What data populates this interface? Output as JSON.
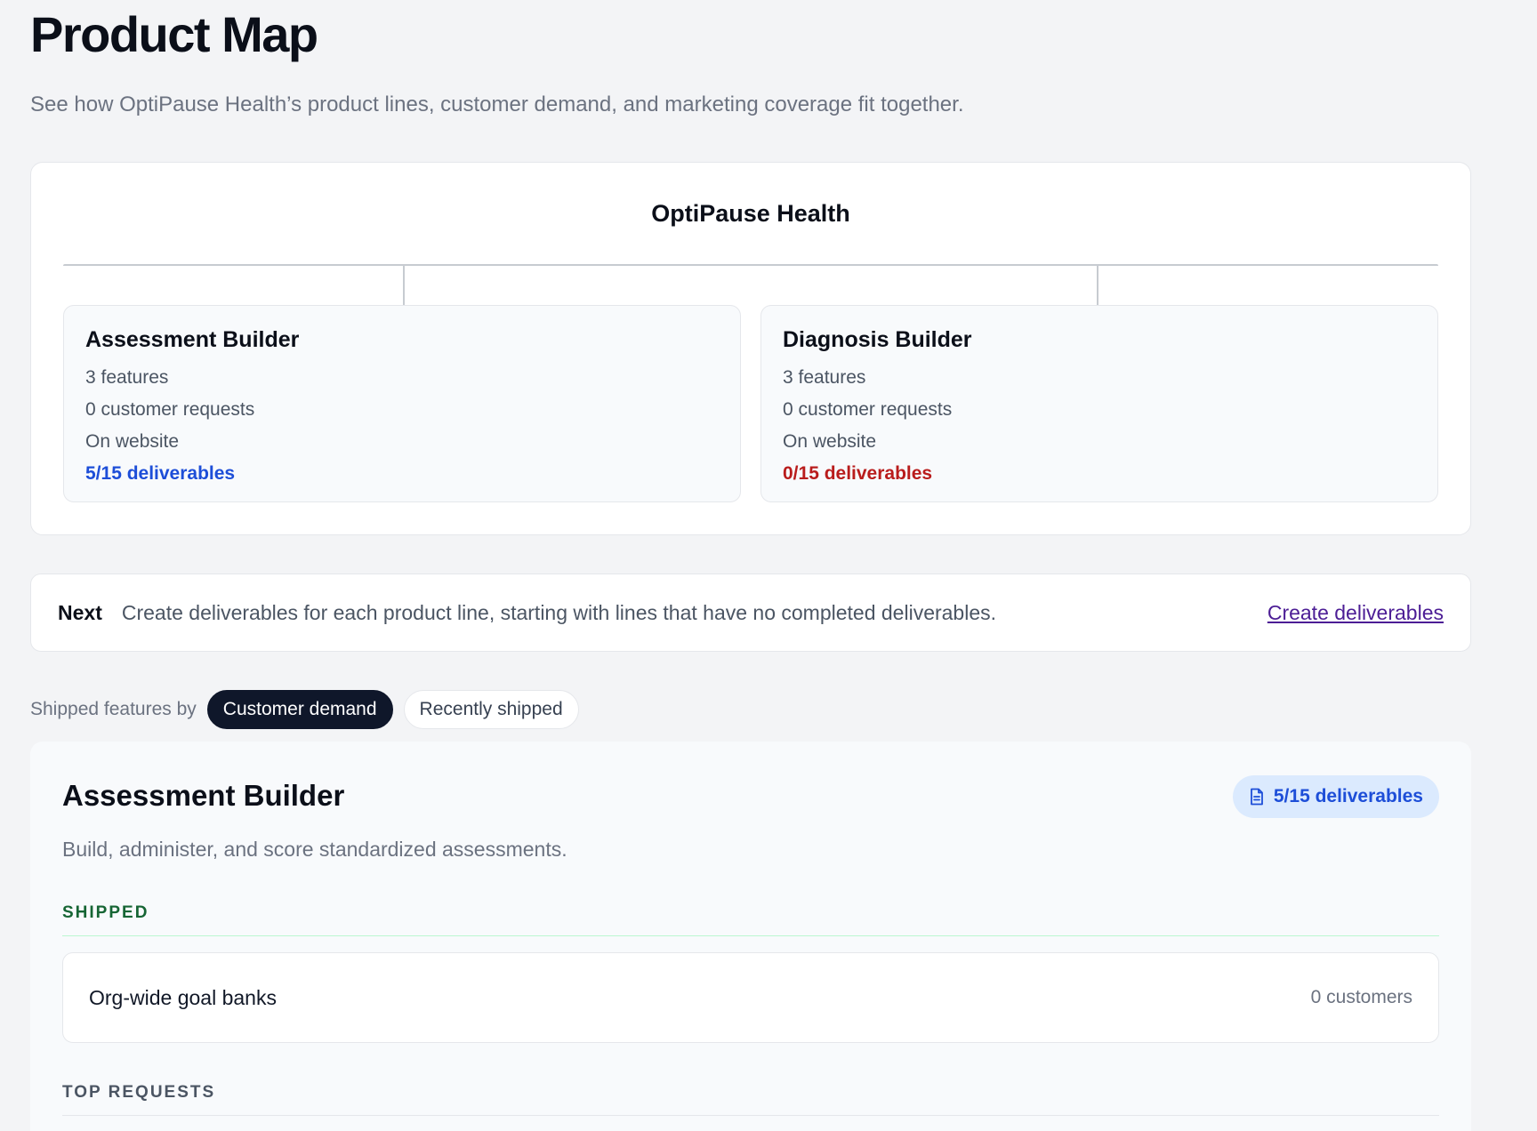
{
  "header": {
    "title": "Product Map",
    "subtitle": "See how OptiPause Health’s product lines, customer demand, and marketing coverage fit together."
  },
  "tree": {
    "root": "OptiPause Health",
    "lines": [
      {
        "name": "Assessment Builder",
        "features": "3 features",
        "requests": "0 customer requests",
        "website": "On website",
        "deliverables": "5/15 deliverables",
        "deliverables_color": "#1d4ed8"
      },
      {
        "name": "Diagnosis Builder",
        "features": "3 features",
        "requests": "0 customer requests",
        "website": "On website",
        "deliverables": "0/15 deliverables",
        "deliverables_color": "#b91c1c"
      }
    ]
  },
  "next": {
    "label": "Next",
    "text": "Create deliverables for each product line, starting with lines that have no completed deliverables.",
    "link": "Create deliverables"
  },
  "filter": {
    "label": "Shipped features by",
    "options": [
      "Customer demand",
      "Recently shipped"
    ],
    "selected": "Customer demand"
  },
  "detail": {
    "title": "Assessment Builder",
    "badge": "5/15 deliverables",
    "badge_icon": "document-icon",
    "description": "Build, administer, and score standardized assessments.",
    "shipped_heading": "SHIPPED",
    "shipped": [
      {
        "name": "Org-wide goal banks",
        "customers": "0 customers"
      }
    ],
    "requests_heading": "TOP REQUESTS"
  },
  "colors": {
    "accent_blue": "#1d4ed8",
    "alert_red": "#b91c1c",
    "shipped_green": "#166534",
    "link_purple": "#4c1d95",
    "chip_active": "#0f172a"
  }
}
